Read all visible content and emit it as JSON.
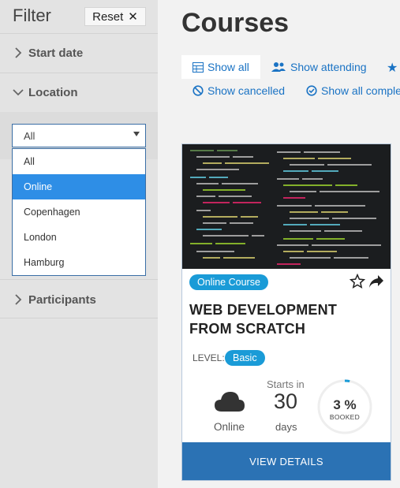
{
  "filter": {
    "title": "Filter",
    "reset_label": "Reset",
    "sections": {
      "start_date": "Start date",
      "location": "Location",
      "participants": "Participants"
    },
    "location_select": {
      "value": "All",
      "options": [
        "All",
        "Online",
        "Copenhagen",
        "London",
        "Hamburg"
      ],
      "highlighted": "Online"
    }
  },
  "main": {
    "title": "Courses",
    "tabs": {
      "show_all": "Show all",
      "show_attending": "Show attending",
      "show_cancelled": "Show cancelled",
      "show_all_completed": "Show all comple"
    }
  },
  "course": {
    "type_badge": "Online Course",
    "title": "WEB DEVELOPMENT FROM SCRATCH",
    "level_label": "LEVEL:",
    "level": "Basic",
    "location": "Online",
    "starts_label": "Starts in",
    "starts_value": "30",
    "starts_unit": "days",
    "booked_percent": "3 %",
    "booked_label": "BOOKED",
    "booked_fraction": 0.03,
    "details_button": "VIEW DETAILS"
  },
  "colors": {
    "accent": "#1a9bd7",
    "link": "#1a73c4",
    "button": "#2b72b4",
    "selected_option": "#2e8ee6"
  }
}
